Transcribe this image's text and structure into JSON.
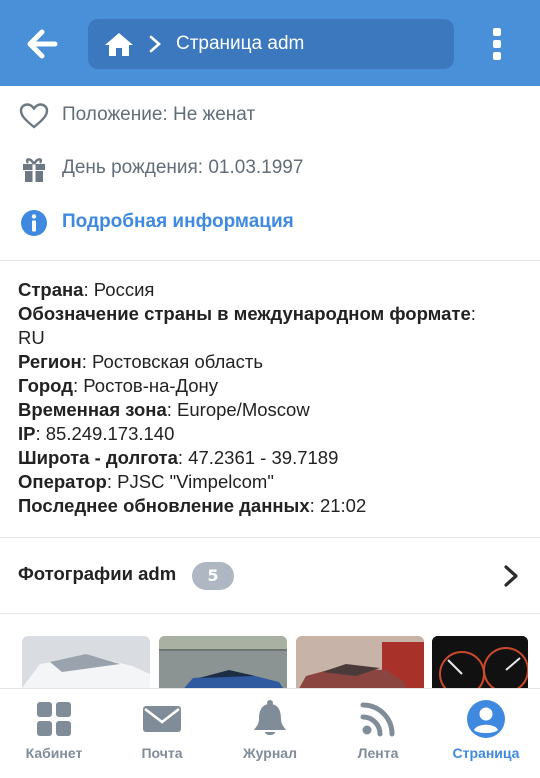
{
  "header": {
    "title": "Страница adm",
    "bg_color": "#4a90d9",
    "icons": [
      "back-arrow-icon",
      "home-icon",
      "chevron-right-icon",
      "kebab-menu-icon"
    ]
  },
  "info": {
    "status": "Положение: Не женат",
    "birthday": "День рождения: 01.03.1997",
    "more_link": "Подробная информация"
  },
  "details": [
    {
      "label": "Страна",
      "value": "Россия"
    },
    {
      "label": "Обозначение страны в международном формате",
      "value": "RU"
    },
    {
      "label": "Регион",
      "value": "Ростовская область"
    },
    {
      "label": "Город",
      "value": "Ростов-на-Дону"
    },
    {
      "label": "Временная зона",
      "value": "Europe/Moscow"
    },
    {
      "label": "IP",
      "value": "85.249.173.140"
    },
    {
      "label": "Широта - долгота",
      "value": "47.2361 - 39.7189"
    },
    {
      "label": "Оператор",
      "value": "PJSC \"Vimpelcom\""
    },
    {
      "label": "Последнее обновление данных",
      "value": "21:02"
    }
  ],
  "photos": {
    "label": "Фотографии adm",
    "count": "5"
  },
  "nav": [
    {
      "label": "Кабинет",
      "icon": "dashboard-icon",
      "active": false
    },
    {
      "label": "Почта",
      "icon": "mail-icon",
      "active": false
    },
    {
      "label": "Журнал",
      "icon": "bell-icon",
      "active": false
    },
    {
      "label": "Лента",
      "icon": "rss-icon",
      "active": false
    },
    {
      "label": "Страница",
      "icon": "profile-icon",
      "active": true
    }
  ],
  "colors": {
    "accent": "#3f8ae0",
    "muted": "#818c99"
  }
}
